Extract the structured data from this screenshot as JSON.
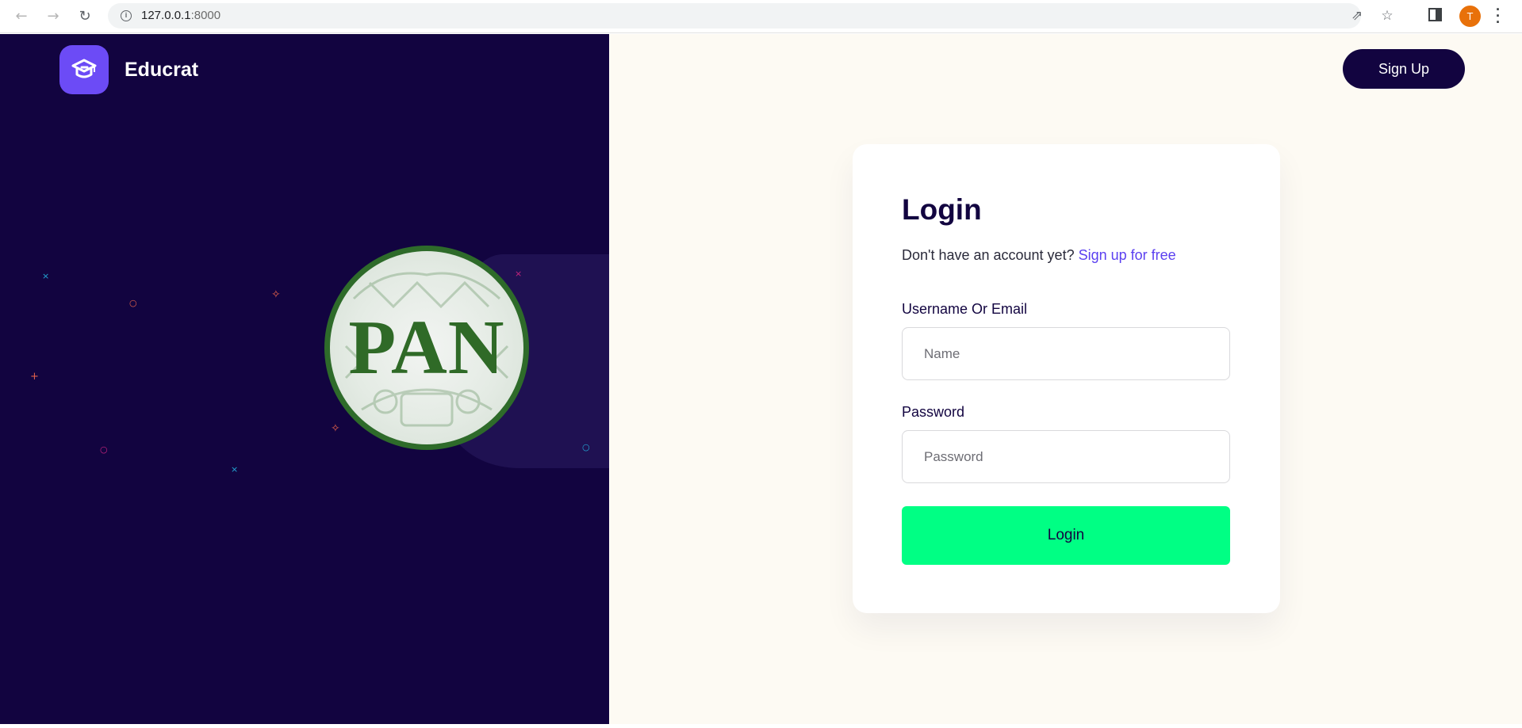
{
  "browser": {
    "url_host": "127.0.0.1",
    "url_port": ":8000",
    "profile_initial": "T"
  },
  "brand": {
    "name": "Educrat",
    "logo_color": "#6c4bf6"
  },
  "hero": {
    "seal_text": "PAN"
  },
  "header": {
    "signup_label": "Sign Up"
  },
  "login": {
    "title": "Login",
    "subtitle_text": "Don't have an account yet?",
    "signup_link": "Sign up for free",
    "username_label": "Username Or Email",
    "username_placeholder": "Name",
    "password_label": "Password",
    "password_placeholder": "Password",
    "submit_label": "Login"
  },
  "colors": {
    "left_bg": "#120440",
    "right_bg": "#fdfaf3",
    "accent": "#5a3ff0",
    "cta": "#00ff84"
  },
  "icons": [
    "back-icon",
    "forward-icon",
    "reload-icon",
    "info-icon",
    "share-icon",
    "star-icon",
    "side-panel-icon",
    "menu-icon",
    "graduation-cap-icon"
  ]
}
